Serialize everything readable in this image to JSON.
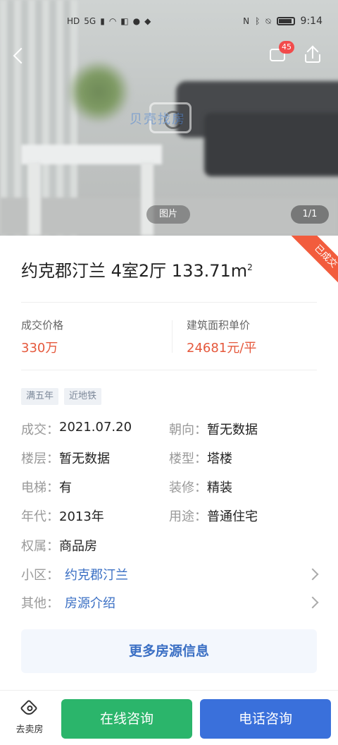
{
  "status_bar": {
    "left_icons": [
      "HD",
      "5G",
      "signal-icon",
      "wifi-icon",
      "app-icon",
      "chat-icon",
      "shield-icon"
    ],
    "right_icons": [
      "nfc-icon",
      "bluetooth-icon",
      "mute-icon",
      "battery-icon"
    ],
    "time": "9:14"
  },
  "nav": {
    "message_badge": "45"
  },
  "hero": {
    "watermark_text": "贝壳找房",
    "photo_tag": "图片",
    "photo_count": "1/1"
  },
  "ribbon": {
    "label": "已成交"
  },
  "listing": {
    "title": "约克郡汀兰 4室2厅 133.71m",
    "title_sup": "2",
    "sold_price_label": "成交价格",
    "sold_price": "330万",
    "unit_price_label": "建筑面积单价",
    "unit_price": "24681元/平",
    "tags": [
      "满五年",
      "近地铁"
    ]
  },
  "details": {
    "deal_k": "成交：",
    "deal_v": "2021.07.20",
    "orient_k": "朝向：",
    "orient_v": "暂无数据",
    "floor_k": "楼层：",
    "floor_v": "暂无数据",
    "type_k": "楼型：",
    "type_v": "塔楼",
    "elevator_k": "电梯：",
    "elevator_v": "有",
    "deco_k": "装修：",
    "deco_v": "精装",
    "year_k": "年代：",
    "year_v": "2013年",
    "use_k": "用途：",
    "use_v": "普通住宅",
    "owner_k": "权属：",
    "owner_v": "商品房",
    "community_k": "小区：",
    "community_v": "约克郡汀兰",
    "other_k": "其他：",
    "other_v": "房源介绍"
  },
  "more_button": "更多房源信息",
  "bottom_bar": {
    "sell_label": "去卖房",
    "online_label": "在线咨询",
    "phone_label": "电话咨询"
  },
  "colors": {
    "price_red": "#e5583c",
    "link_blue": "#3a6fc4",
    "online_green": "#2bb56b",
    "phone_blue": "#3a70db",
    "ribbon_orange": "#f25c3d"
  }
}
